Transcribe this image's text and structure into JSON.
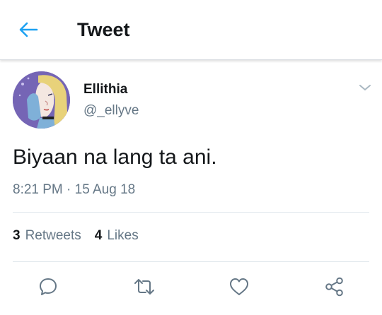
{
  "header": {
    "title": "Tweet",
    "back_icon": "arrow-left-icon"
  },
  "tweet": {
    "display_name": "Ellithia",
    "handle": "@_ellyve",
    "text": "Biyaan na lang ta ani.",
    "time": "8:21 PM",
    "separator": " · ",
    "date": "15 Aug 18",
    "caret_icon": "chevron-down-icon"
  },
  "stats": {
    "retweets_count": "3",
    "retweets_label": "Retweets",
    "likes_count": "4",
    "likes_label": "Likes"
  },
  "actions": {
    "reply_icon": "reply-icon",
    "retweet_icon": "retweet-icon",
    "like_icon": "heart-icon",
    "share_icon": "share-icon"
  },
  "colors": {
    "accent": "#1da1f2",
    "secondary_text": "#657786",
    "icon_gray": "#657786",
    "divider": "#e1e8ed"
  }
}
